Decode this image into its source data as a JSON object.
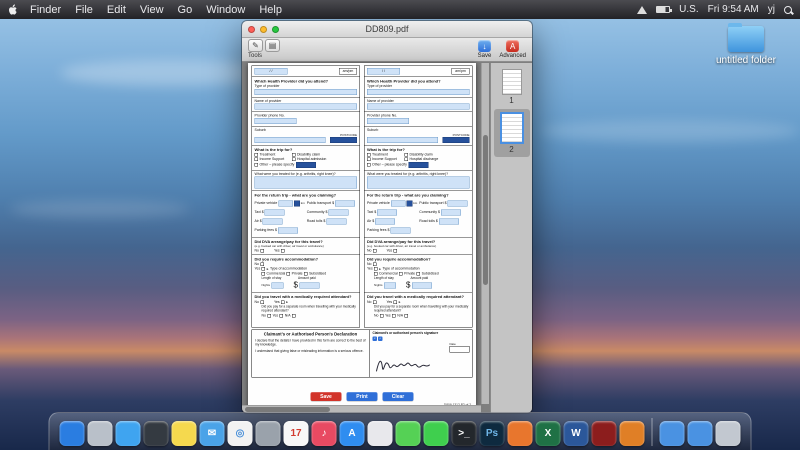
{
  "menu_bar": {
    "items": [
      "Finder",
      "File",
      "Edit",
      "View",
      "Go",
      "Window",
      "Help"
    ],
    "status": {
      "input_source": "U.S.",
      "clock": "Fri 9:54 AM",
      "user": "yj"
    }
  },
  "desktop": {
    "folder_label": "untitled folder"
  },
  "window": {
    "title": "DD809.pdf",
    "toolbar": {
      "tools_label": "Tools",
      "icons": [
        {
          "name": "annotate-icon",
          "glyph": "✎"
        },
        {
          "name": "stamp-icon",
          "glyph": "▤"
        }
      ],
      "save_label": "Save",
      "save_glyph": "↓",
      "advanced_label": "Advanced",
      "advanced_glyph": "A"
    },
    "sidebar": {
      "pages": [
        {
          "label": "1"
        },
        {
          "label": "2"
        }
      ]
    },
    "footer_buttons": [
      {
        "label": "Save",
        "color": "#d2342a"
      },
      {
        "label": "Print",
        "color": "#2f6fd8"
      },
      {
        "label": "Clear",
        "color": "#2f6fd8"
      }
    ]
  },
  "form": {
    "columns": [
      {
        "top_date": "/      /",
        "top_ampm": "am/pm",
        "provider_heading": "Which Health Provider did you attend?",
        "type_label": "Type of provider",
        "name_label": "Name of provider",
        "phone_label": "Provider phone No.",
        "phone_prefix": "(      )",
        "suburb_label": "Suburb",
        "postcode_label": "POSTCODE",
        "trip_heading": "What is the trip for?",
        "options": [
          "Treatment",
          "Disability claim",
          "Income Support",
          "Hospital admission"
        ],
        "other_label": "Other – please specify",
        "treated_label": "What were you treated for (e.g. arthritis, right knee)?",
        "claim_heading": "For the return trip - what are you claiming?",
        "rows": {
          "private": "Private vehicle",
          "km": "km",
          "public": "Public transport",
          "taxi": "Taxi",
          "community": "Community",
          "air": "Air",
          "tolls": "Road tolls",
          "parking": "Parking fees",
          "dollar": "$"
        },
        "dva_heading": "Did DVA arrange/pay for this travel?",
        "dva_sub": "(e.g. booked car with driver, air travel or ambulance)",
        "no": "No",
        "yes": "Yes",
        "na": "N/A",
        "accom_heading": "Did you require accommodation?",
        "accom_type_label": "Type of accommodation",
        "accom_options": [
          "Commercial",
          "Private",
          "Subsidised"
        ],
        "stay_label": "Length of stay",
        "amount_label": "Amount paid",
        "nights_label": "Nights",
        "attendant_heading": "Did you travel with a medically required attendant?",
        "separate_room": "Did you pay for a separate room when travelling with your medically required attendant?"
      },
      {
        "top_date": "/      /",
        "top_ampm": "am/pm",
        "provider_heading": "Which Health Provider did you attend?",
        "type_label": "Type of provider",
        "name_label": "Name of provider",
        "phone_label": "Provider phone No.",
        "phone_prefix": "(      )",
        "suburb_label": "Suburb",
        "postcode_label": "POSTCODE",
        "trip_heading": "What is the trip for?",
        "options": [
          "Treatment",
          "Disability claim",
          "Income Support",
          "Hospital discharge"
        ],
        "other_label": "Other – please specify",
        "treated_label": "What were you treated for (e.g. arthritis, right knee)?",
        "claim_heading": "For the return trip - what are you claiming?",
        "rows": {
          "private": "Private vehicle",
          "km": "km",
          "public": "Public transport",
          "taxi": "Taxi",
          "community": "Community",
          "air": "Air",
          "tolls": "Road tolls",
          "parking": "Parking fees",
          "dollar": "$"
        },
        "dva_heading": "Did DVA arrange/pay for this travel?",
        "dva_sub": "(e.g. booked car with driver, air travel or ambulance)",
        "no": "No",
        "yes": "Yes",
        "na": "N/A",
        "accom_heading": "Did you require accommodation?",
        "accom_type_label": "Type of accommodation",
        "accom_options": [
          "Commercial",
          "Private",
          "Subsidised"
        ],
        "stay_label": "Length of stay",
        "amount_label": "Amount paid",
        "nights_label": "Nights",
        "attendant_heading": "Did you travel with a medically required attendant?",
        "separate_room": "Did you pay for a separate room when travelling with your medically required attendant?"
      }
    ],
    "declaration": {
      "title": "Claimant's or Authorised Person's Declaration",
      "body1": "I declare that the details I have provided in this form are correct to the best of my knowledge.",
      "body2": "I understand that giving false or misleading information is a serious offence.",
      "signature_label": "Claimant's or authorised person's signature",
      "date_label": "Date",
      "form_code": "D809 1312 P2 of 2"
    }
  },
  "dock": {
    "apps": [
      {
        "name": "finder",
        "color": "#2a7de1",
        "glyph": "",
        "fg": "#ffffff"
      },
      {
        "name": "launchpad",
        "color": "#b9c0c9",
        "glyph": "",
        "fg": "#555555"
      },
      {
        "name": "safari",
        "color": "#3fa4f0",
        "glyph": "",
        "fg": "#ffffff"
      },
      {
        "name": "activity-monitor",
        "color": "#343a41",
        "glyph": "",
        "fg": "#7fe07f"
      },
      {
        "name": "notes",
        "color": "#f5d94e",
        "glyph": "",
        "fg": "#555555"
      },
      {
        "name": "mail",
        "color": "#4aa3e8",
        "glyph": "✉",
        "fg": "#ffffff"
      },
      {
        "name": "chrome",
        "color": "#f2f2f2",
        "glyph": "◎",
        "fg": "#4a90d9"
      },
      {
        "name": "system-preferences",
        "color": "#9aa2ab",
        "glyph": "",
        "fg": "#ffffff"
      },
      {
        "name": "calendar",
        "color": "#f7f7f7",
        "glyph": "17",
        "fg": "#d23b2f"
      },
      {
        "name": "itunes",
        "color": "#e84a62",
        "glyph": "♪",
        "fg": "#ffffff"
      },
      {
        "name": "app-store",
        "color": "#2f8df0",
        "glyph": "A",
        "fg": "#ffffff"
      },
      {
        "name": "photos",
        "color": "#e8e8ec",
        "glyph": "",
        "fg": "#888888"
      },
      {
        "name": "messages",
        "color": "#55d155",
        "glyph": "",
        "fg": "#ffffff"
      },
      {
        "name": "facetime",
        "color": "#3fcf4e",
        "glyph": "",
        "fg": "#ffffff"
      },
      {
        "name": "terminal",
        "color": "#23272c",
        "glyph": ">_",
        "fg": "#ffffff"
      },
      {
        "name": "photoshop",
        "color": "#0e2a3f",
        "glyph": "Ps",
        "fg": "#6fb6e8"
      },
      {
        "name": "firefox",
        "color": "#e8762d",
        "glyph": "",
        "fg": "#ffffff"
      },
      {
        "name": "excel",
        "color": "#1f7145",
        "glyph": "X",
        "fg": "#ffffff"
      },
      {
        "name": "word",
        "color": "#2b579a",
        "glyph": "W",
        "fg": "#ffffff"
      },
      {
        "name": "acrobat",
        "color": "#8c1d1d",
        "glyph": "",
        "fg": "#ffffff"
      },
      {
        "name": "vlc",
        "color": "#e07f26",
        "glyph": "",
        "fg": "#ffffff"
      }
    ],
    "extras": [
      {
        "name": "downloads-folder",
        "color": "#4a92e2",
        "glyph": "",
        "fg": "#ffffff"
      },
      {
        "name": "documents-folder",
        "color": "#4a92e2",
        "glyph": "",
        "fg": "#ffffff"
      },
      {
        "name": "trash",
        "color": "#c2c8d0",
        "glyph": "",
        "fg": "#888888"
      }
    ]
  }
}
